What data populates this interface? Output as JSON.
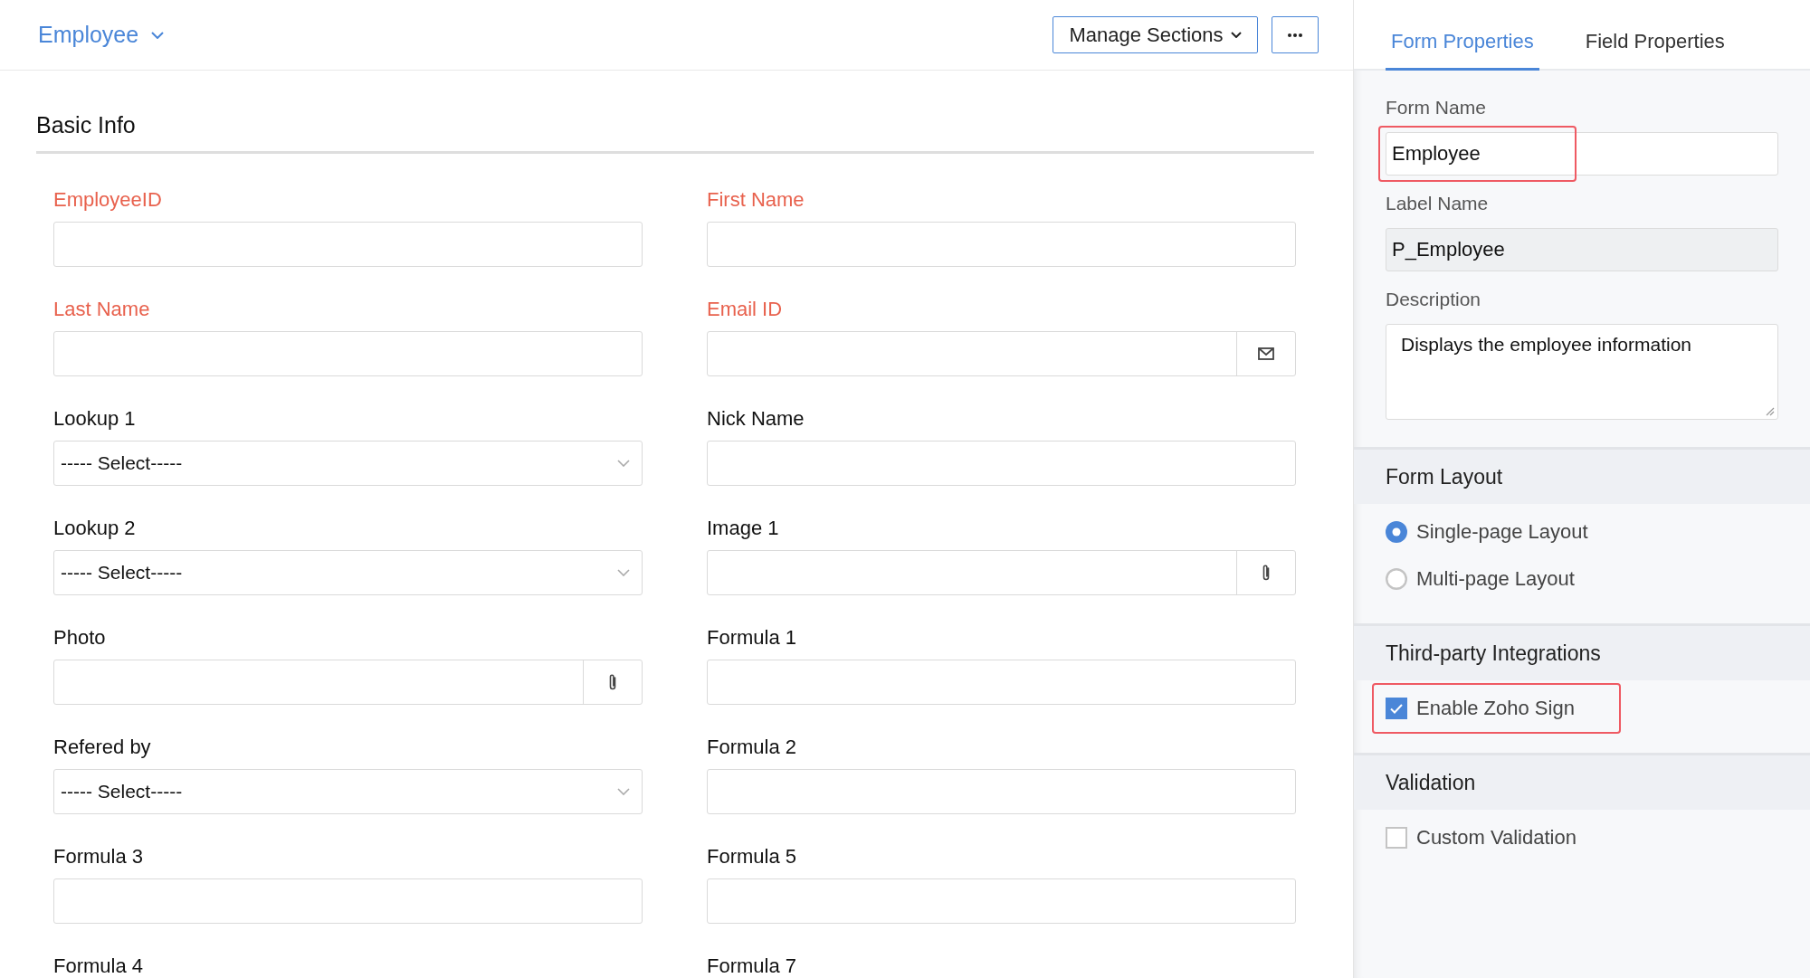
{
  "header": {
    "title": "Employee",
    "manage_button": "Manage Sections"
  },
  "section": {
    "title": "Basic Info"
  },
  "fields": [
    {
      "label": "EmployeeID",
      "required": true,
      "kind": "text"
    },
    {
      "label": "First Name",
      "required": true,
      "kind": "text"
    },
    {
      "label": "Last Name",
      "required": true,
      "kind": "text"
    },
    {
      "label": "Email ID",
      "required": true,
      "kind": "email"
    },
    {
      "label": "Lookup 1",
      "required": false,
      "kind": "select",
      "value": "----- Select-----"
    },
    {
      "label": "Nick Name",
      "required": false,
      "kind": "text"
    },
    {
      "label": "Lookup 2",
      "required": false,
      "kind": "select",
      "value": "----- Select-----"
    },
    {
      "label": "Image 1",
      "required": false,
      "kind": "file"
    },
    {
      "label": "Photo",
      "required": false,
      "kind": "file"
    },
    {
      "label": "Formula 1",
      "required": false,
      "kind": "text"
    },
    {
      "label": "Refered by",
      "required": false,
      "kind": "select",
      "value": "----- Select-----"
    },
    {
      "label": "Formula 2",
      "required": false,
      "kind": "text"
    },
    {
      "label": "Formula 3",
      "required": false,
      "kind": "text"
    },
    {
      "label": "Formula 5",
      "required": false,
      "kind": "text"
    },
    {
      "label": "Formula 4",
      "required": false,
      "kind": "label"
    },
    {
      "label": "Formula 7",
      "required": false,
      "kind": "label"
    }
  ],
  "tabs": [
    {
      "label": "Form Properties",
      "selected": true
    },
    {
      "label": "Field Properties",
      "selected": false
    }
  ],
  "properties": [
    {
      "label": "Form Name",
      "value": "Employee",
      "kind": "input",
      "disabled": false,
      "highlighted": true
    },
    {
      "label": "Label Name",
      "value": "P_Employee",
      "kind": "input",
      "disabled": true,
      "highlighted": false
    },
    {
      "label": "Description",
      "value": "Displays the employee information",
      "kind": "textarea",
      "disabled": false,
      "highlighted": false
    }
  ],
  "panel_sections": [
    {
      "title": "Form Layout",
      "options": [
        {
          "kind": "radio",
          "label": "Single-page Layout",
          "selected": true,
          "highlighted": false
        },
        {
          "kind": "radio",
          "label": "Multi-page Layout",
          "selected": false,
          "highlighted": false
        }
      ]
    },
    {
      "title": "Third-party Integrations",
      "options": [
        {
          "kind": "checkbox",
          "label": "Enable Zoho Sign",
          "checked": true,
          "highlighted": true
        }
      ]
    },
    {
      "title": "Validation",
      "options": [
        {
          "kind": "checkbox",
          "label": "Custom Validation",
          "checked": false,
          "highlighted": false
        }
      ]
    }
  ]
}
